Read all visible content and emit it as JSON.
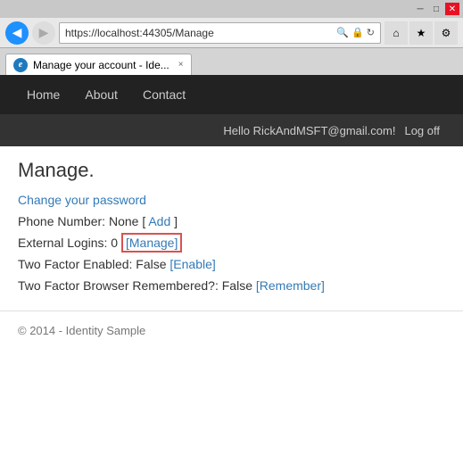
{
  "titlebar": {
    "min_label": "─",
    "max_label": "□",
    "close_label": "✕"
  },
  "addressbar": {
    "back_icon": "◀",
    "forward_icon": "▶",
    "url": "https://localhost:44305/Manage",
    "search_icon": "🔍",
    "lock_icon": "🔒",
    "refresh_icon": "↻",
    "home_icon": "⌂",
    "favorites_icon": "★",
    "settings_icon": "⚙"
  },
  "tab": {
    "title": "Manage your account - Ide...",
    "close": "×"
  },
  "nav": {
    "items": [
      "Home",
      "About",
      "Contact"
    ]
  },
  "userbar": {
    "greeting": "Hello RickAndMSFT@gmail.com!",
    "logoff": "Log off"
  },
  "main": {
    "title": "Manage.",
    "change_password_link": "Change your password",
    "phone_number_label": "Phone Number:",
    "phone_number_value": "None",
    "phone_add_link": "Add",
    "external_logins_label": "External Logins:",
    "external_logins_count": "0",
    "external_manage_link": "[Manage]",
    "two_factor_label": "Two Factor Enabled:",
    "two_factor_value": "False",
    "two_factor_enable_link": "[Enable]",
    "two_factor_browser_label": "Two Factor Browser Remembered?:",
    "two_factor_browser_value": "False",
    "two_factor_remember_link": "[Remember]"
  },
  "footer": {
    "text": "© 2014 - Identity Sample"
  }
}
